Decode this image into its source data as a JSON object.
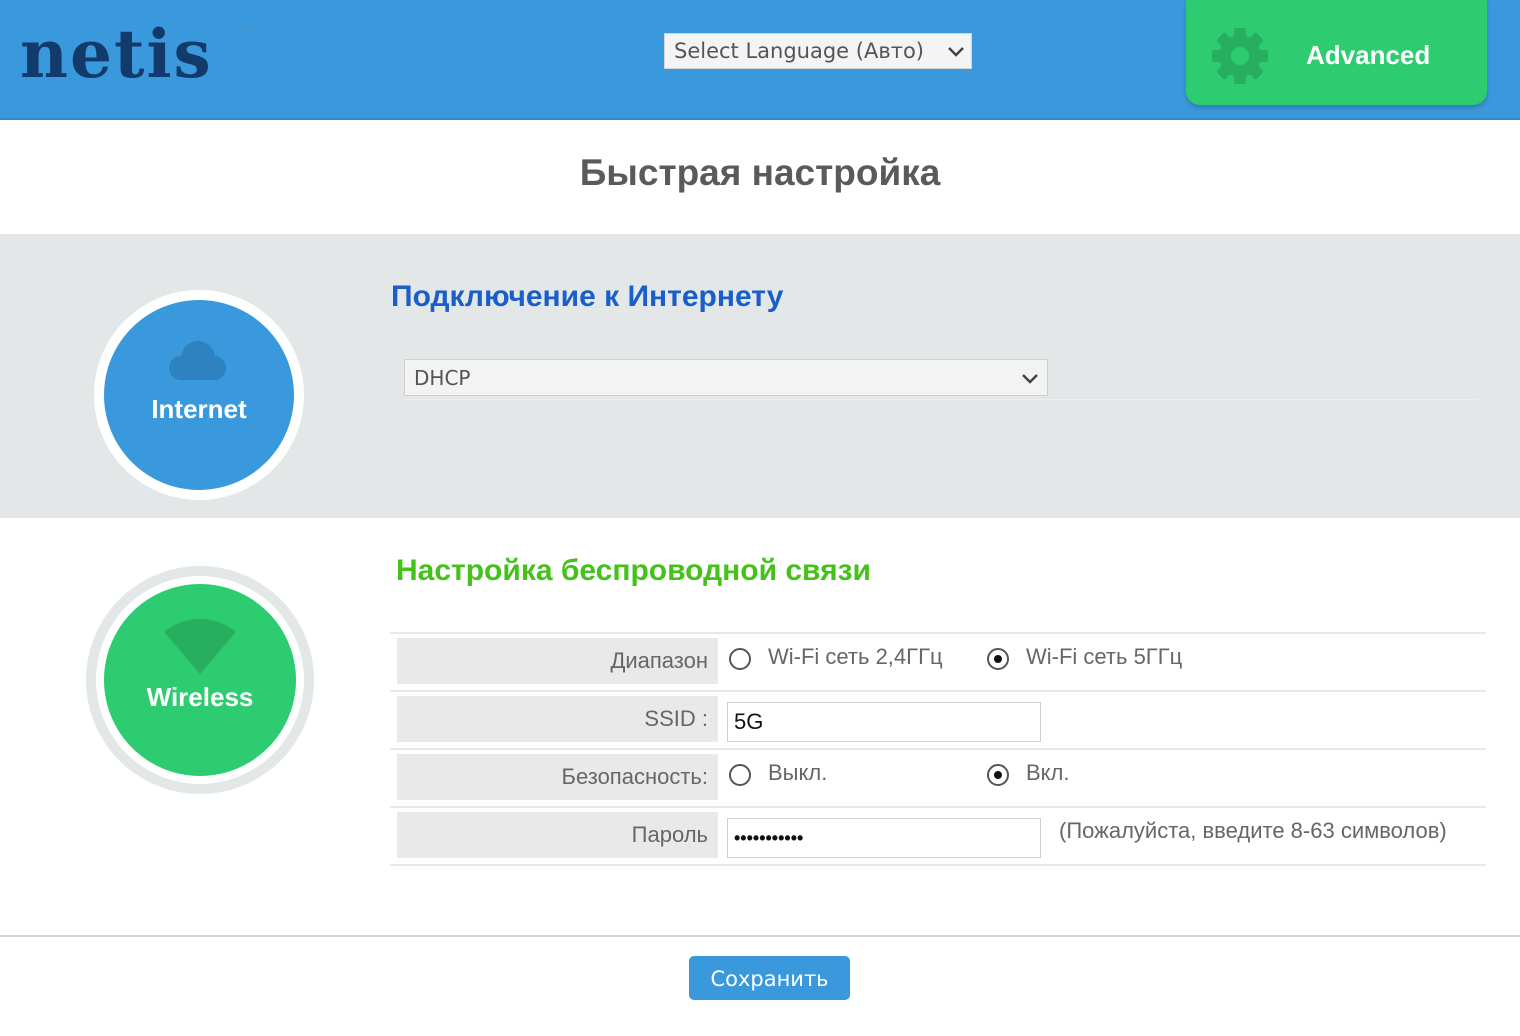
{
  "header": {
    "logo_text": "netis",
    "logo_mark": "®",
    "language_select": {
      "selected": "Select Language (Авто)"
    },
    "advanced_button": {
      "label": "Advanced",
      "icon": "gear-icon"
    }
  },
  "page_title": "Быстрая настройка",
  "internet_section": {
    "badge_label": "Internet",
    "badge_icon": "cloud-icon",
    "title": "Подключение к Интернету",
    "connection_type": {
      "selected": "DHCP"
    },
    "colors": {
      "badge": "#3a98dc",
      "title": "#1a5fc9",
      "background": "#e3e7e8"
    }
  },
  "wireless_section": {
    "badge_label": "Wireless",
    "badge_icon": "wifi-icon",
    "title": "Настройка беспроводной связи",
    "colors": {
      "badge": "#2ecc71",
      "title": "#44c21a"
    },
    "rows": {
      "band": {
        "label": "Диапазон",
        "options": [
          {
            "label": "Wi-Fi сеть 2,4ГГц",
            "checked": false
          },
          {
            "label": "Wi-Fi сеть 5ГГц",
            "checked": true
          }
        ]
      },
      "ssid": {
        "label": "SSID :",
        "value": "5G"
      },
      "security": {
        "label": "Безопасность:",
        "options": [
          {
            "label": "Выкл.",
            "checked": false
          },
          {
            "label": "Вкл.",
            "checked": true
          }
        ]
      },
      "password": {
        "label": "Пароль",
        "value": "•••••••••••",
        "hint": "(Пожалуйста, введите 8-63 символов)"
      }
    }
  },
  "footer": {
    "save_label": "Сохранить"
  }
}
